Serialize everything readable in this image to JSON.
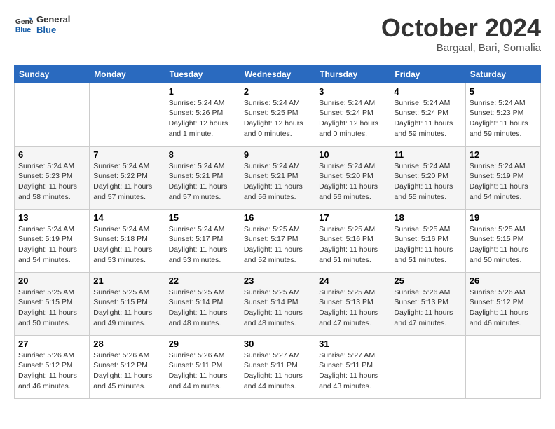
{
  "header": {
    "logo": {
      "line1": "General",
      "line2": "Blue"
    },
    "month": "October 2024",
    "location": "Bargaal, Bari, Somalia"
  },
  "weekdays": [
    "Sunday",
    "Monday",
    "Tuesday",
    "Wednesday",
    "Thursday",
    "Friday",
    "Saturday"
  ],
  "weeks": [
    [
      {
        "day": "",
        "sunrise": "",
        "sunset": "",
        "daylight": ""
      },
      {
        "day": "",
        "sunrise": "",
        "sunset": "",
        "daylight": ""
      },
      {
        "day": "1",
        "sunrise": "Sunrise: 5:24 AM",
        "sunset": "Sunset: 5:26 PM",
        "daylight": "Daylight: 12 hours and 1 minute."
      },
      {
        "day": "2",
        "sunrise": "Sunrise: 5:24 AM",
        "sunset": "Sunset: 5:25 PM",
        "daylight": "Daylight: 12 hours and 0 minutes."
      },
      {
        "day": "3",
        "sunrise": "Sunrise: 5:24 AM",
        "sunset": "Sunset: 5:24 PM",
        "daylight": "Daylight: 12 hours and 0 minutes."
      },
      {
        "day": "4",
        "sunrise": "Sunrise: 5:24 AM",
        "sunset": "Sunset: 5:24 PM",
        "daylight": "Daylight: 11 hours and 59 minutes."
      },
      {
        "day": "5",
        "sunrise": "Sunrise: 5:24 AM",
        "sunset": "Sunset: 5:23 PM",
        "daylight": "Daylight: 11 hours and 59 minutes."
      }
    ],
    [
      {
        "day": "6",
        "sunrise": "Sunrise: 5:24 AM",
        "sunset": "Sunset: 5:23 PM",
        "daylight": "Daylight: 11 hours and 58 minutes."
      },
      {
        "day": "7",
        "sunrise": "Sunrise: 5:24 AM",
        "sunset": "Sunset: 5:22 PM",
        "daylight": "Daylight: 11 hours and 57 minutes."
      },
      {
        "day": "8",
        "sunrise": "Sunrise: 5:24 AM",
        "sunset": "Sunset: 5:21 PM",
        "daylight": "Daylight: 11 hours and 57 minutes."
      },
      {
        "day": "9",
        "sunrise": "Sunrise: 5:24 AM",
        "sunset": "Sunset: 5:21 PM",
        "daylight": "Daylight: 11 hours and 56 minutes."
      },
      {
        "day": "10",
        "sunrise": "Sunrise: 5:24 AM",
        "sunset": "Sunset: 5:20 PM",
        "daylight": "Daylight: 11 hours and 56 minutes."
      },
      {
        "day": "11",
        "sunrise": "Sunrise: 5:24 AM",
        "sunset": "Sunset: 5:20 PM",
        "daylight": "Daylight: 11 hours and 55 minutes."
      },
      {
        "day": "12",
        "sunrise": "Sunrise: 5:24 AM",
        "sunset": "Sunset: 5:19 PM",
        "daylight": "Daylight: 11 hours and 54 minutes."
      }
    ],
    [
      {
        "day": "13",
        "sunrise": "Sunrise: 5:24 AM",
        "sunset": "Sunset: 5:19 PM",
        "daylight": "Daylight: 11 hours and 54 minutes."
      },
      {
        "day": "14",
        "sunrise": "Sunrise: 5:24 AM",
        "sunset": "Sunset: 5:18 PM",
        "daylight": "Daylight: 11 hours and 53 minutes."
      },
      {
        "day": "15",
        "sunrise": "Sunrise: 5:24 AM",
        "sunset": "Sunset: 5:17 PM",
        "daylight": "Daylight: 11 hours and 53 minutes."
      },
      {
        "day": "16",
        "sunrise": "Sunrise: 5:25 AM",
        "sunset": "Sunset: 5:17 PM",
        "daylight": "Daylight: 11 hours and 52 minutes."
      },
      {
        "day": "17",
        "sunrise": "Sunrise: 5:25 AM",
        "sunset": "Sunset: 5:16 PM",
        "daylight": "Daylight: 11 hours and 51 minutes."
      },
      {
        "day": "18",
        "sunrise": "Sunrise: 5:25 AM",
        "sunset": "Sunset: 5:16 PM",
        "daylight": "Daylight: 11 hours and 51 minutes."
      },
      {
        "day": "19",
        "sunrise": "Sunrise: 5:25 AM",
        "sunset": "Sunset: 5:15 PM",
        "daylight": "Daylight: 11 hours and 50 minutes."
      }
    ],
    [
      {
        "day": "20",
        "sunrise": "Sunrise: 5:25 AM",
        "sunset": "Sunset: 5:15 PM",
        "daylight": "Daylight: 11 hours and 50 minutes."
      },
      {
        "day": "21",
        "sunrise": "Sunrise: 5:25 AM",
        "sunset": "Sunset: 5:15 PM",
        "daylight": "Daylight: 11 hours and 49 minutes."
      },
      {
        "day": "22",
        "sunrise": "Sunrise: 5:25 AM",
        "sunset": "Sunset: 5:14 PM",
        "daylight": "Daylight: 11 hours and 48 minutes."
      },
      {
        "day": "23",
        "sunrise": "Sunrise: 5:25 AM",
        "sunset": "Sunset: 5:14 PM",
        "daylight": "Daylight: 11 hours and 48 minutes."
      },
      {
        "day": "24",
        "sunrise": "Sunrise: 5:25 AM",
        "sunset": "Sunset: 5:13 PM",
        "daylight": "Daylight: 11 hours and 47 minutes."
      },
      {
        "day": "25",
        "sunrise": "Sunrise: 5:26 AM",
        "sunset": "Sunset: 5:13 PM",
        "daylight": "Daylight: 11 hours and 47 minutes."
      },
      {
        "day": "26",
        "sunrise": "Sunrise: 5:26 AM",
        "sunset": "Sunset: 5:12 PM",
        "daylight": "Daylight: 11 hours and 46 minutes."
      }
    ],
    [
      {
        "day": "27",
        "sunrise": "Sunrise: 5:26 AM",
        "sunset": "Sunset: 5:12 PM",
        "daylight": "Daylight: 11 hours and 46 minutes."
      },
      {
        "day": "28",
        "sunrise": "Sunrise: 5:26 AM",
        "sunset": "Sunset: 5:12 PM",
        "daylight": "Daylight: 11 hours and 45 minutes."
      },
      {
        "day": "29",
        "sunrise": "Sunrise: 5:26 AM",
        "sunset": "Sunset: 5:11 PM",
        "daylight": "Daylight: 11 hours and 44 minutes."
      },
      {
        "day": "30",
        "sunrise": "Sunrise: 5:27 AM",
        "sunset": "Sunset: 5:11 PM",
        "daylight": "Daylight: 11 hours and 44 minutes."
      },
      {
        "day": "31",
        "sunrise": "Sunrise: 5:27 AM",
        "sunset": "Sunset: 5:11 PM",
        "daylight": "Daylight: 11 hours and 43 minutes."
      },
      {
        "day": "",
        "sunrise": "",
        "sunset": "",
        "daylight": ""
      },
      {
        "day": "",
        "sunrise": "",
        "sunset": "",
        "daylight": ""
      }
    ]
  ]
}
